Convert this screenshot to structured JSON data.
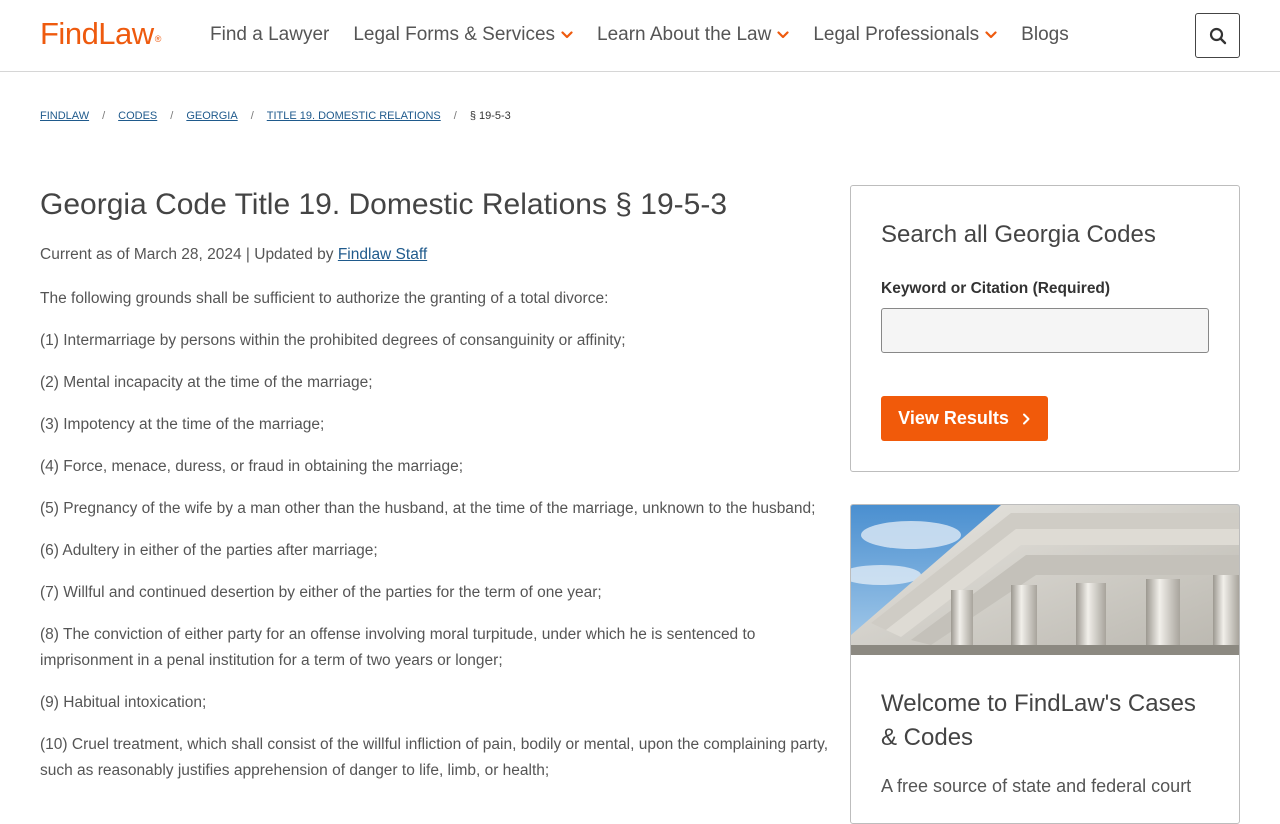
{
  "header": {
    "logo": "FindLaw",
    "logo_mark": "®",
    "nav": [
      {
        "label": "Find a Lawyer",
        "has_dropdown": false
      },
      {
        "label": "Legal Forms & Services",
        "has_dropdown": true
      },
      {
        "label": "Learn About the Law",
        "has_dropdown": true
      },
      {
        "label": "Legal Professionals",
        "has_dropdown": true
      },
      {
        "label": "Blogs",
        "has_dropdown": false
      }
    ],
    "search_icon": "search-icon"
  },
  "breadcrumb": {
    "items": [
      "FINDLAW",
      "CODES",
      "GEORGIA",
      "TITLE 19. DOMESTIC RELATIONS"
    ],
    "separator": "/",
    "current": "§ 19-5-3"
  },
  "main": {
    "title": "Georgia Code Title 19. Domestic Relations § 19-5-3",
    "meta_prefix": "Current as of March 28, 2024 | Updated by ",
    "meta_author": "Findlaw Staff",
    "paragraphs": [
      "The following grounds shall be sufficient to authorize the granting of a total divorce:",
      "(1) Intermarriage by persons within the prohibited degrees of consanguinity or affinity;",
      "(2) Mental incapacity at the time of the marriage;",
      "(3) Impotency at the time of the marriage;",
      "(4) Force, menace, duress, or fraud in obtaining the marriage;",
      "(5) Pregnancy of the wife by a man other than the husband, at the time of the marriage, unknown to the husband;",
      "(6) Adultery in either of the parties after marriage;",
      "(7) Willful and continued desertion by either of the parties for the term of one year;",
      "(8) The conviction of either party for an offense involving moral turpitude, under which he is sentenced to imprisonment in a penal institution for a term of two years or longer;",
      "(9) Habitual intoxication;",
      "(10) Cruel treatment, which shall consist of the willful infliction of pain, bodily or mental, upon the complaining party, such as reasonably justifies apprehension of danger to life, limb, or health;"
    ]
  },
  "sidebar": {
    "search": {
      "title": "Search all Georgia Codes",
      "label": "Keyword or Citation (Required)",
      "value": "",
      "button": "View Results"
    },
    "welcome": {
      "title": "Welcome to FindLaw's Cases & Codes",
      "text": "A free source of state and federal court"
    }
  },
  "colors": {
    "brand_orange": "#f15a0a",
    "link_blue": "#1f5a8c"
  }
}
